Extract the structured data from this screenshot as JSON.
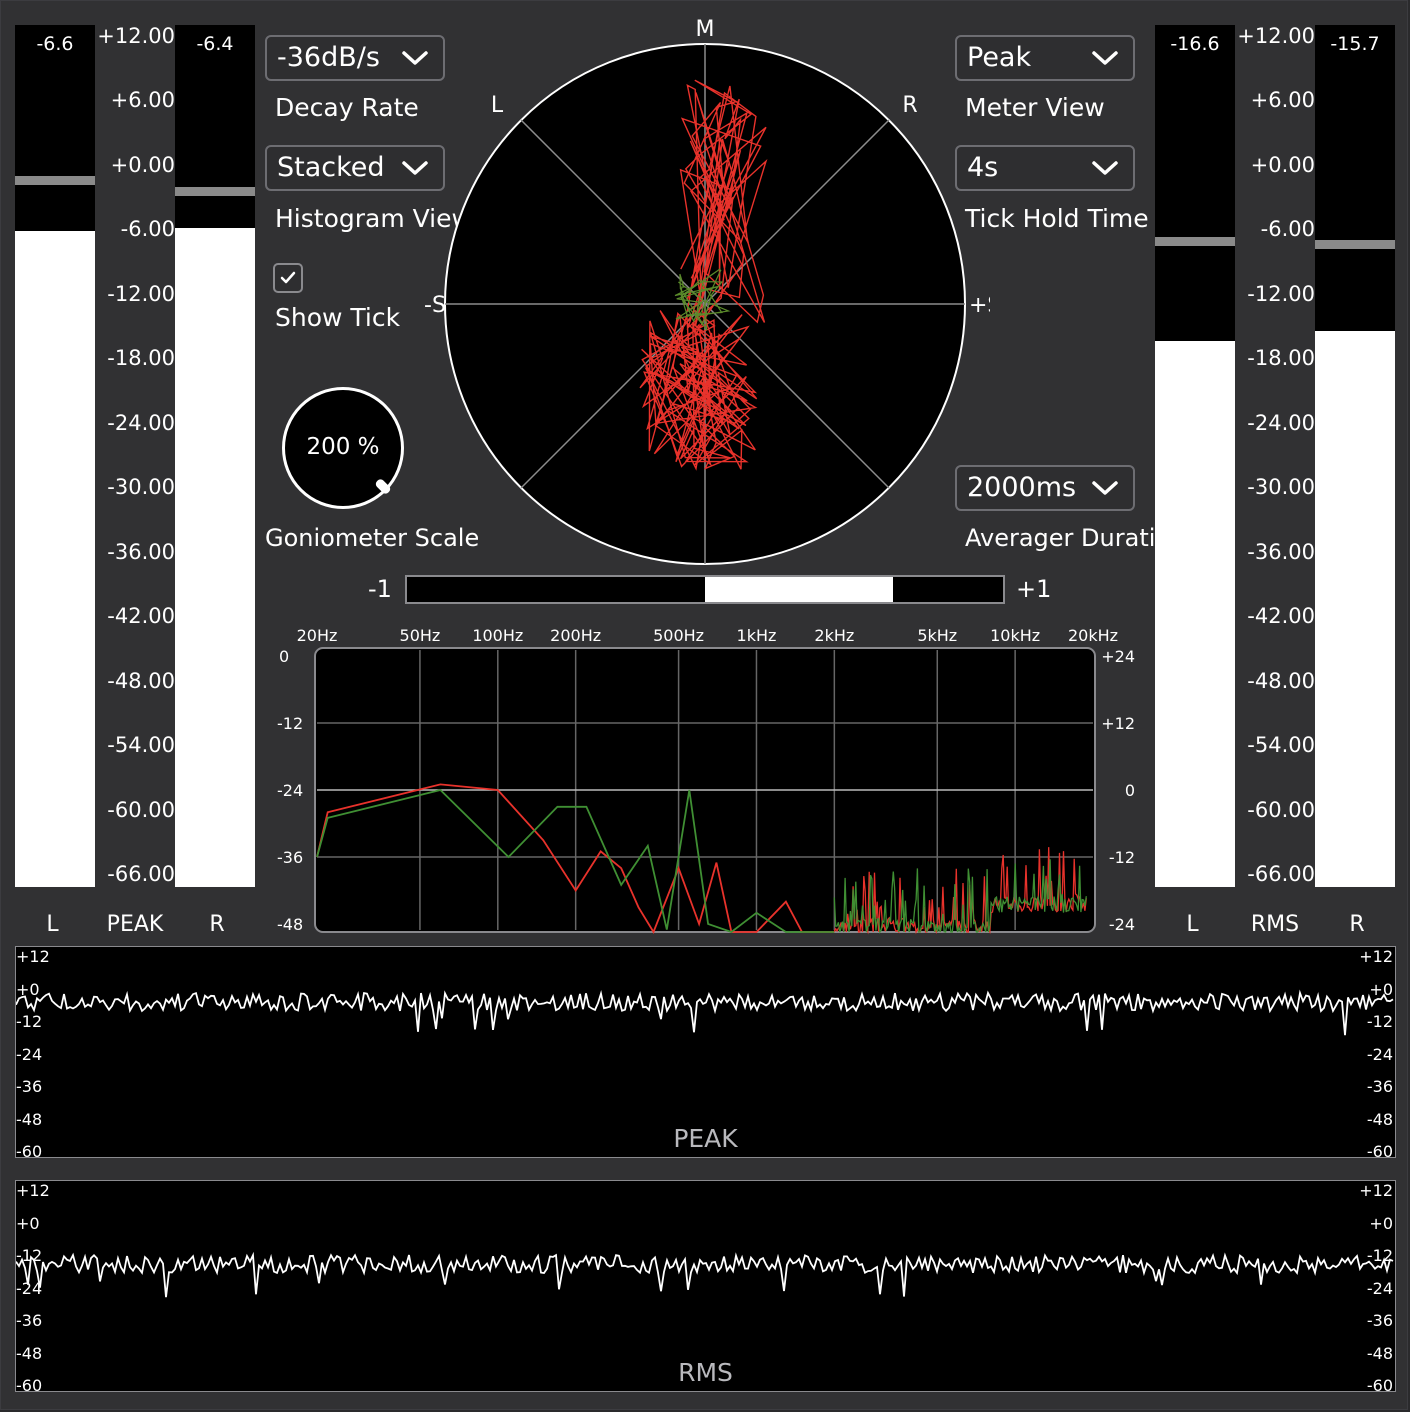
{
  "colors": {
    "background": "#313133",
    "meter_fill": "#ffffff",
    "peak_hold": "#8a8a8a",
    "trace_left": "#e8322b",
    "trace_right": "#3f8f33"
  },
  "peak_meter": {
    "left": {
      "label": "L",
      "value_text": "-6.6",
      "level_db": -6.6,
      "hold_db": -2.0
    },
    "right": {
      "label": "R",
      "value_text": "-6.4",
      "level_db": -6.4,
      "hold_db": -3.0
    },
    "scale_label": "PEAK",
    "scale": [
      "+12.00",
      "+6.00",
      "+0.00",
      "-6.00",
      "-12.00",
      "-18.00",
      "-24.00",
      "-30.00",
      "-36.00",
      "-42.00",
      "-48.00",
      "-54.00",
      "-60.00",
      "-66.00"
    ]
  },
  "rms_meter": {
    "left": {
      "label": "L",
      "value_text": "-16.6",
      "level_db": -16.6,
      "hold_db": -7.5
    },
    "right": {
      "label": "R",
      "value_text": "-15.7",
      "level_db": -15.7,
      "hold_db": -7.8
    },
    "scale_label": "RMS",
    "scale": [
      "+12.00",
      "+6.00",
      "+0.00",
      "-6.00",
      "-12.00",
      "-18.00",
      "-24.00",
      "-30.00",
      "-36.00",
      "-42.00",
      "-48.00",
      "-54.00",
      "-60.00",
      "-66.00"
    ]
  },
  "controls": {
    "decay_rate": {
      "value": "-36dB/s",
      "label": "Decay Rate"
    },
    "histogram_view": {
      "value": "Stacked",
      "label": "Histogram View"
    },
    "show_tick": {
      "checked": true,
      "label": "Show Tick"
    },
    "goniometer_scale": {
      "value": "200 %",
      "label": "Goniometer Scale"
    },
    "meter_view": {
      "value": "Peak",
      "label": "Meter View"
    },
    "tick_hold_time": {
      "value": "4s",
      "label": "Tick Hold Time"
    },
    "averager_duration": {
      "value": "2000ms",
      "label": "Averager Duration"
    }
  },
  "goniometer": {
    "labels": {
      "top": "M",
      "left": "L",
      "right": "R",
      "side_neg": "-S",
      "side_pos": "+S"
    }
  },
  "correlation": {
    "min_label": "-1",
    "max_label": "+1",
    "value_from": 0.0,
    "value_to": 0.63
  },
  "spectrum": {
    "freq_labels": [
      "20Hz",
      "50Hz",
      "100Hz",
      "200Hz",
      "500Hz",
      "1kHz",
      "2kHz",
      "5kHz",
      "10kHz",
      "20kHz"
    ],
    "left_axis": [
      "0",
      "-12",
      "-24",
      "-36",
      "-48"
    ],
    "right_axis": [
      "+24",
      "+12",
      "0",
      "-12",
      "-24"
    ],
    "series": [
      {
        "name": "left",
        "color": "#e8322b",
        "points": [
          [
            20,
            -36
          ],
          [
            22,
            -28
          ],
          [
            60,
            -23
          ],
          [
            100,
            -24
          ],
          [
            150,
            -33
          ],
          [
            200,
            -42
          ],
          [
            250,
            -35
          ],
          [
            300,
            -38
          ],
          [
            350,
            -45
          ],
          [
            400,
            -50
          ],
          [
            500,
            -38
          ],
          [
            600,
            -48
          ],
          [
            700,
            -37
          ],
          [
            800,
            -52
          ],
          [
            1000,
            -52
          ],
          [
            1300,
            -44
          ],
          [
            1500,
            -52
          ],
          [
            2000,
            -52
          ]
        ]
      },
      {
        "name": "right",
        "color": "#3f8f33",
        "points": [
          [
            20,
            -36
          ],
          [
            22,
            -29
          ],
          [
            60,
            -24
          ],
          [
            110,
            -36
          ],
          [
            170,
            -27
          ],
          [
            220,
            -27
          ],
          [
            300,
            -41
          ],
          [
            380,
            -34
          ],
          [
            450,
            -49
          ],
          [
            550,
            -24
          ],
          [
            650,
            -48
          ],
          [
            800,
            -52
          ],
          [
            1000,
            -46
          ],
          [
            1300,
            -52
          ],
          [
            2000,
            -52
          ]
        ]
      }
    ]
  },
  "history_peak": {
    "title": "PEAK",
    "axis": [
      "+12",
      "+0",
      "-12",
      "-24",
      "-36",
      "-48",
      "-60"
    ]
  },
  "history_rms": {
    "title": "RMS",
    "axis": [
      "+12",
      "+0",
      "-12",
      "-24",
      "-36",
      "-48",
      "-60"
    ]
  }
}
